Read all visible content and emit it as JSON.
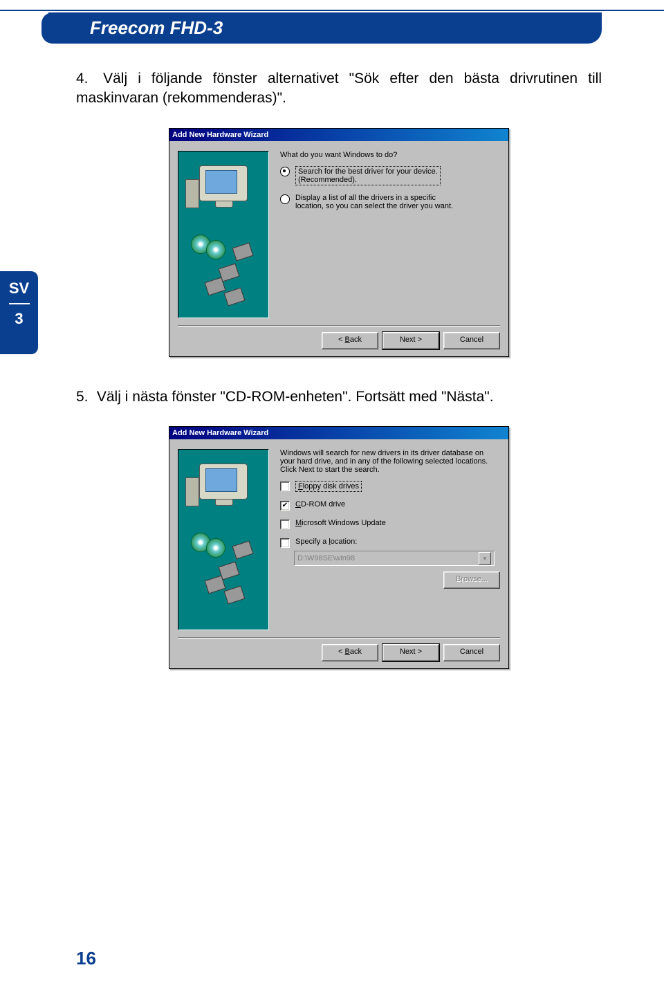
{
  "header": {
    "title": "Freecom FHD-3"
  },
  "sideTab": {
    "lang": "SV",
    "chapter": "3"
  },
  "pageNumber": "16",
  "step4": {
    "num": "4.",
    "text": "Välj i följande fönster alternativet \"Sök efter den bästa drivrutinen till maskinvaran (rekommenderas)\"."
  },
  "step5": {
    "num": "5.",
    "text": "Välj i nästa fönster \"CD-ROM-enheten\". Fortsätt med \"Nästa\"."
  },
  "dialog1": {
    "title": "Add New Hardware Wizard",
    "prompt": "What do you want Windows to do?",
    "opt1_line1": "Search for the best driver for your device.",
    "opt1_line2": "(Recommended).",
    "opt2_line1": "Display a list of all the drivers in a specific",
    "opt2_line2": "location, so you can select the driver you want.",
    "back": "< Back",
    "next": "Next >",
    "cancel": "Cancel"
  },
  "dialog2": {
    "title": "Add New Hardware Wizard",
    "intro": "Windows will search for new drivers in its driver database on your hard drive, and in any of the following selected locations. Click Next to start the search.",
    "chk1": "Floppy disk drives",
    "chk2": "CD-ROM drive",
    "chk3": "Microsoft Windows Update",
    "chk4": "Specify a location:",
    "path": "D:\\W98SE\\win98",
    "browse": "Browse...",
    "back": "< Back",
    "next": "Next >",
    "cancel": "Cancel"
  }
}
